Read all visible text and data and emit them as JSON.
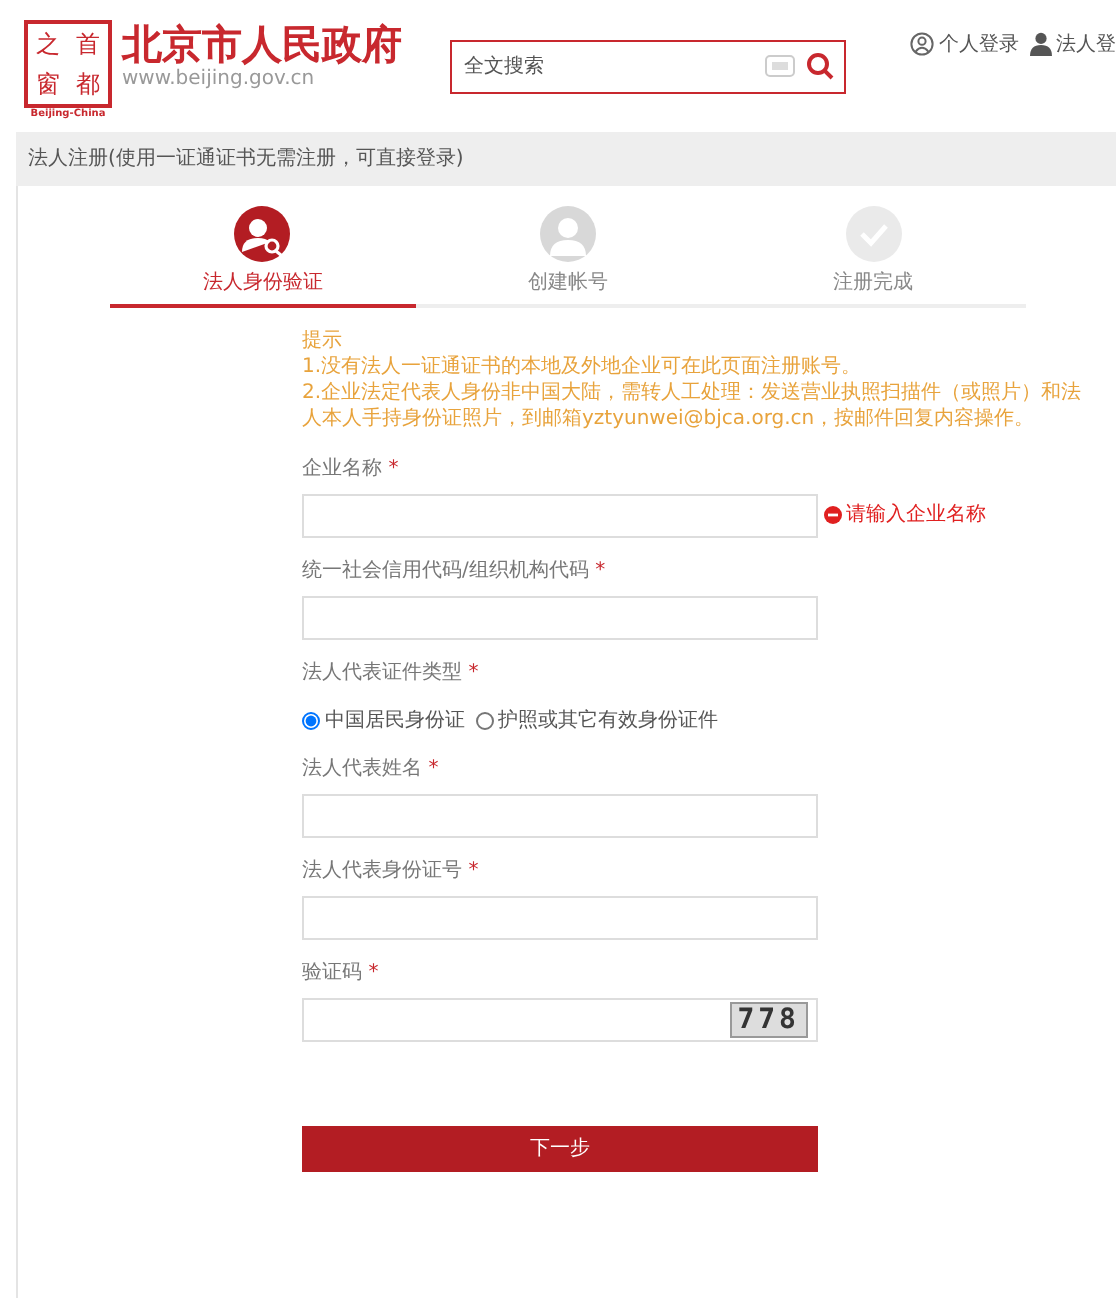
{
  "header": {
    "logo_seal": [
      "之",
      "首",
      "窗",
      "都"
    ],
    "logo_caption": "Beijing-China",
    "site_title": "北京市人民政府",
    "site_url": "www.beijing.gov.cn",
    "search": {
      "placeholder": "全文搜索"
    },
    "links": [
      {
        "label": "个人登录",
        "kind": "circle"
      },
      {
        "label": "法人登",
        "kind": "person"
      }
    ]
  },
  "page_title": "法人注册(使用一证通证书无需注册，可直接登录)",
  "steps": [
    {
      "label": "法人身份验证",
      "selected": true,
      "kind": "verify"
    },
    {
      "label": "创建帐号",
      "selected": false,
      "kind": "person"
    },
    {
      "label": "注册完成",
      "selected": false,
      "kind": "check"
    }
  ],
  "notice": [
    "提示",
    "1.没有法人一证通证书的本地及外地企业可在此页面注册账号。",
    "2.企业法定代表人身份非中国大陆，需转人工处理：发送营业执照扫描件（或照片）和法人本人手持身份证照片，到邮箱yztyunwei@bjca.org.cn，按邮件回复内容操作。"
  ],
  "fields": [
    {
      "kind": "text",
      "label": "企业名称",
      "required": "*",
      "error": "请输入企业名称"
    },
    {
      "kind": "text",
      "label": "统一社会信用代码/组织机构代码",
      "required": "*"
    },
    {
      "kind": "radio",
      "label": "法人代表证件类型",
      "required": "*",
      "options": [
        {
          "label": "中国居民身份证",
          "selected": true
        },
        {
          "label": "护照或其它有效身份证件",
          "selected": false
        }
      ]
    },
    {
      "kind": "text",
      "label": "法人代表姓名",
      "required": "*"
    },
    {
      "kind": "text",
      "label": "法人代表身份证号",
      "required": "*"
    },
    {
      "kind": "captcha",
      "label": "验证码",
      "required": "*",
      "captcha": "778"
    }
  ],
  "submit": "下一步"
}
